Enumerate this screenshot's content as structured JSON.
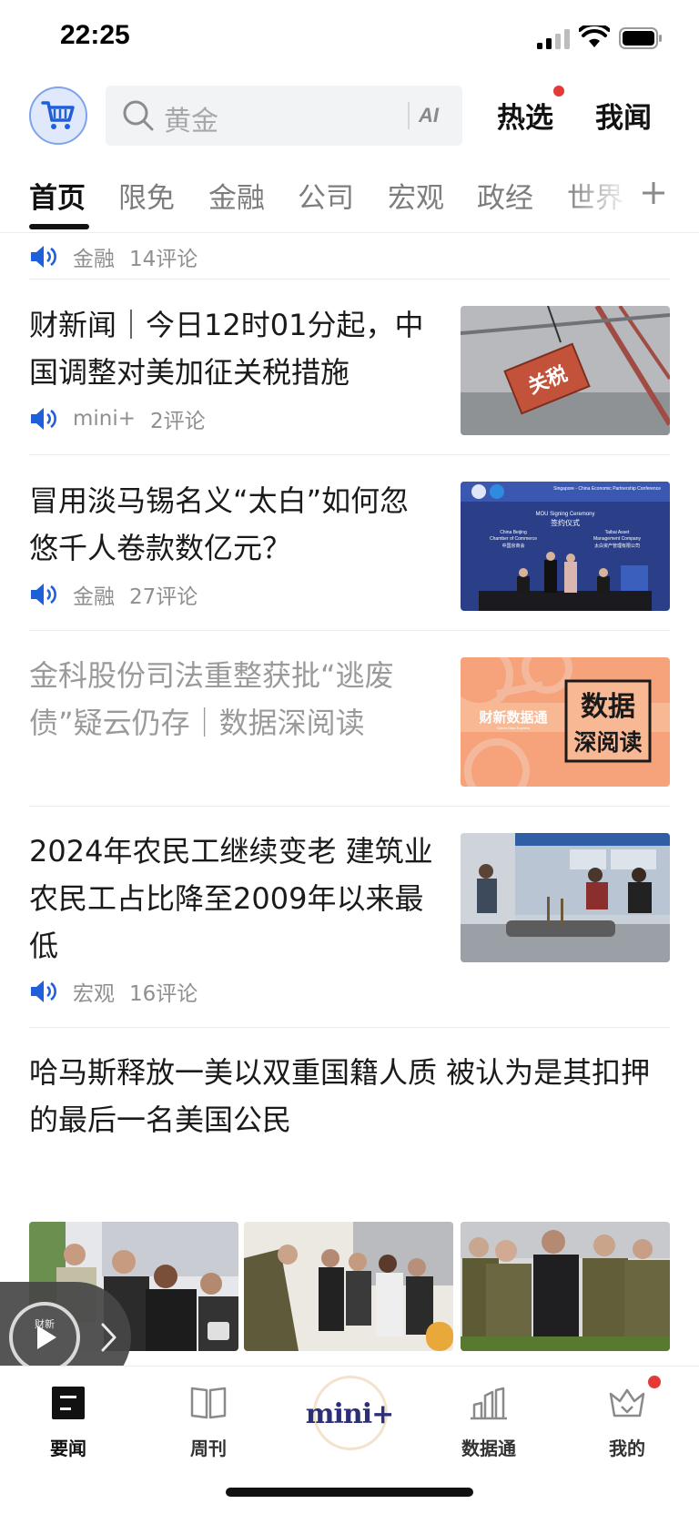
{
  "status_bar": {
    "time": "22:25"
  },
  "header": {
    "search_placeholder": "黄金",
    "ai_label": "AI",
    "hot_picks": "热选",
    "my_news": "我闻"
  },
  "tabs": [
    "首页",
    "限免",
    "金融",
    "公司",
    "宏观",
    "政经",
    "世界"
  ],
  "feed": {
    "top_meta": {
      "tag": "金融",
      "comments": "14评论"
    },
    "articles": [
      {
        "title": "财新闻｜今日12时01分起，中国调整对美加征关税措施",
        "tag": "mini+",
        "comments": "2评论",
        "image_text": "关税"
      },
      {
        "title": "冒用淡马锡名义“太白”如何忽悠千人卷款数亿元？",
        "tag": "金融",
        "comments": "27评论",
        "image_text": {
          "top": "Singapore - China Economic Partnership Conference",
          "ceremony_en": "MOU Signing Ceremony",
          "ceremony_cn": "签约仪式",
          "left_en1": "China Beijing",
          "left_en2": "Chamber of Commerce",
          "left_cn": "中国京商会",
          "right_en1": "Taibai Asset",
          "right_en2": "Management Company",
          "right_cn": "太白资产管理有限公司"
        }
      },
      {
        "title": "金科股份司法重整获批“逃废债”疑云仍存｜数据深阅读",
        "image_text": {
          "brand": "财新数据通",
          "brand_en": "Caixin Data Express",
          "badge1": "数据",
          "badge2": "深阅读"
        }
      },
      {
        "title": "2024年农民工继续变老 建筑业农民工占比降至2009年以来最低",
        "tag": "宏观",
        "comments": "16评论"
      },
      {
        "title": "哈马斯释放一美以双重国籍人质 被认为是其扣押的最后一名美国公民"
      }
    ]
  },
  "audio_player": {
    "brand": "财新"
  },
  "bottom_nav": {
    "news": "要闻",
    "weekly": "周刊",
    "center": "mini+",
    "data": "数据通",
    "me": "我的"
  },
  "colors": {
    "accent_blue": "#1f5fd9",
    "dot_red": "#e53935",
    "mini_navy": "#2b2f7a",
    "data_orange": "#f6a27a"
  }
}
